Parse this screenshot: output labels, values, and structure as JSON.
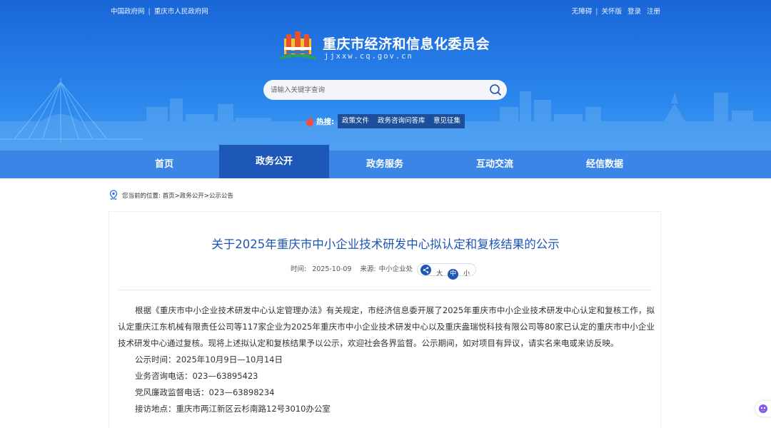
{
  "topbar": {
    "links_left": [
      "中国政府网",
      "重庆市人民政府网"
    ],
    "accessibility": "无障碍",
    "care_mode": "关怀版",
    "login": "登录",
    "register": "注册"
  },
  "site": {
    "title": "重庆市经济和信息化委员会",
    "domain": "jjxxw.cq.gov.cn"
  },
  "search": {
    "placeholder": "请输入关键字查询"
  },
  "hot": {
    "label": "热搜:",
    "tags": [
      "政策文件",
      "政务咨询问答库",
      "意见征集"
    ]
  },
  "nav": {
    "items": [
      "首页",
      "政务公开",
      "政务服务",
      "互动交流",
      "经信数据"
    ],
    "active": "政务公开"
  },
  "breadcrumb": {
    "prefix": "您当前的位置:",
    "items": [
      "首页",
      "政务公开",
      "公示公告"
    ]
  },
  "article": {
    "title": "关于2025年重庆市中小企业技术研发中心拟认定和复核结果的公示",
    "time_label": "时间:",
    "time": "2025-10-09",
    "source_label": "来源:",
    "source": "中小企业处",
    "font_sizes": [
      "大",
      "中",
      "小"
    ],
    "font_size_active": "中",
    "paragraph": "根据《重庆市中小企业技术研发中心认定管理办法》有关规定，市经济信息委开展了2025年重庆市中小企业技术研发中心认定和复核工作，拟认定重庆江东机械有限责任公司等117家企业为2025年重庆市中小企业技术研发中心以及重庆盎瑞悦科技有限公司等80家已认定的重庆市中小企业技术研发中心通过复核。现将上述拟认定和复核结果予以公示，欢迎社会各界监督。公示期间，如对项目有异议，请实名来电或来访反映。",
    "lines": [
      "公示时间：2025年10月9日—10月14日",
      "业务咨询电话：023—63895423",
      "党风廉政监督电话：023—63898234",
      "接访地点：重庆市两江新区云杉南路12号3010办公室"
    ]
  },
  "colors": {
    "header_blue": "#2a86ec",
    "nav_blue": "#3a85e6",
    "nav_active": "#1d58b8",
    "title_blue": "#1e56b5",
    "tag_bg": "#1c4e9a"
  }
}
